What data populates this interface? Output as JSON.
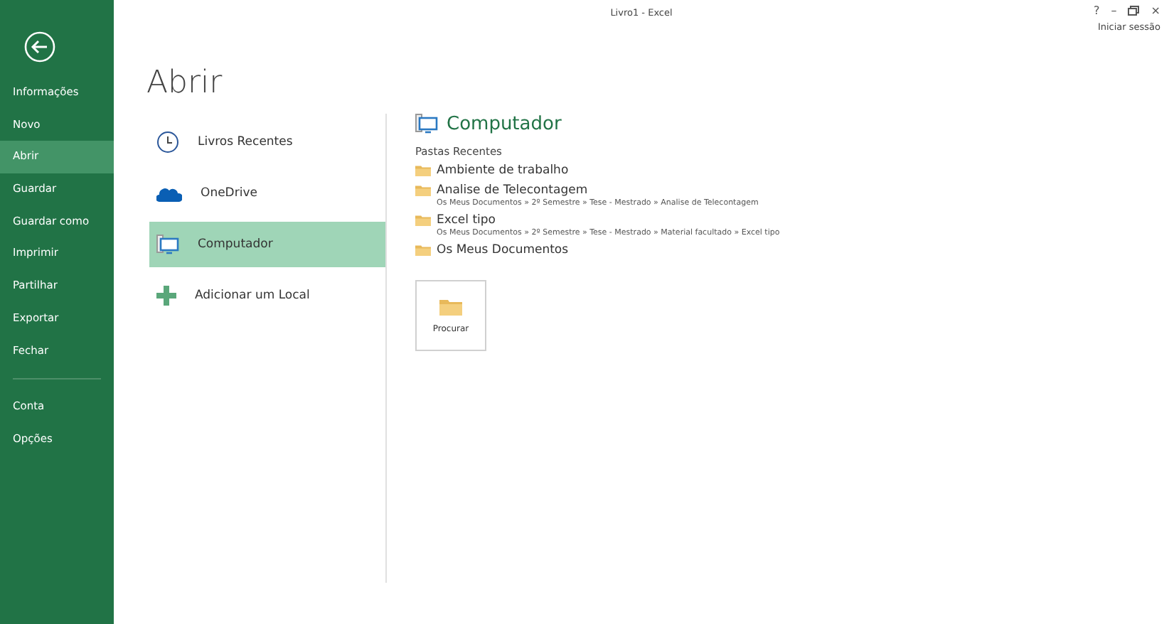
{
  "window": {
    "title": "Livro1 - Excel",
    "controls": [
      "?",
      "–",
      "×"
    ],
    "sign_in": "Iniciar sessão"
  },
  "backstage": {
    "items": [
      {
        "label": "Informações",
        "selected": false
      },
      {
        "label": "Novo",
        "selected": false
      },
      {
        "label": "Abrir",
        "selected": true
      },
      {
        "label": "Guardar",
        "selected": false
      },
      {
        "label": "Guardar como",
        "selected": false
      },
      {
        "label": "Imprimir",
        "selected": false
      },
      {
        "label": "Partilhar",
        "selected": false
      },
      {
        "label": "Exportar",
        "selected": false
      },
      {
        "label": "Fechar",
        "selected": false
      }
    ],
    "account_items": [
      {
        "label": "Conta",
        "selected": false
      },
      {
        "label": "Opções",
        "selected": false
      }
    ]
  },
  "page_title": "Abrir",
  "places": [
    {
      "kind": "recent",
      "label": "Livros Recentes",
      "selected": false
    },
    {
      "kind": "cloud",
      "label": "OneDrive",
      "selected": false
    },
    {
      "kind": "computer",
      "label": "Computador",
      "selected": true
    },
    {
      "kind": "add",
      "label": "Adicionar um Local",
      "selected": false
    }
  ],
  "detail": {
    "heading": "Computador",
    "section": "Pastas Recentes",
    "folders": [
      {
        "name": "Ambiente de trabalho"
      },
      {
        "name": "Analise de Telecontagem",
        "path": "Os Meus Documentos » 2º Semestre » Tese - Mestrado » Analise de Telecontagem"
      },
      {
        "name": "Excel tipo",
        "path": "Os Meus Documentos » 2º Semestre » Tese - Mestrado » Material facultado » Excel tipo"
      },
      {
        "name": "Os Meus Documentos"
      }
    ],
    "browse": "Procurar"
  }
}
